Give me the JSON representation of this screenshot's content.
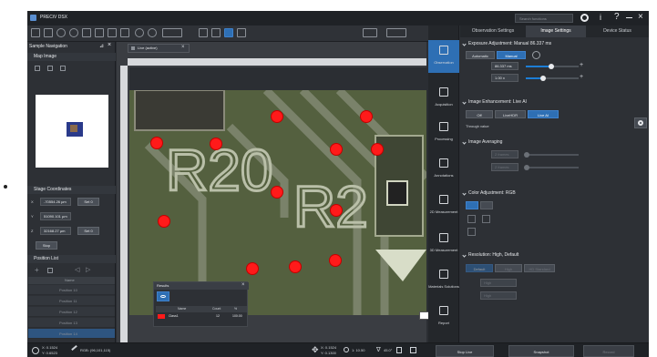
{
  "app": {
    "brand": "PRECiV DSX",
    "search_placeholder": "Search functions"
  },
  "left_panel": {
    "title": "Sample Navigation",
    "map_image": {
      "label": "Map Image"
    },
    "stage": {
      "label": "Stage Coordinates",
      "x_label": "X",
      "x_value": "-70554.26 µm",
      "y_label": "Y",
      "y_value": "51090.101 µm",
      "z_label": "Z",
      "z_value": "32168.27 µm",
      "set_label": "Set 0",
      "stop_label": "Stop"
    },
    "position_list": {
      "label": "Position List",
      "column": "Name",
      "items": [
        "Position 10",
        "Position 11",
        "Position 12",
        "Position 13",
        "Position 14"
      ]
    }
  },
  "canvas": {
    "tab_label": "Live (active)",
    "scale_label": "1 mm"
  },
  "results": {
    "title": "Results",
    "columns": [
      "Name",
      "Count",
      "%"
    ],
    "row": {
      "name": "Class1",
      "count": "12",
      "percent": "100.00"
    }
  },
  "sidebar": {
    "items": [
      "Observation",
      "Acquisition",
      "Processing",
      "Annotations",
      "2D Measurement",
      "3D Measurement",
      "Materials Solutions",
      "Report"
    ]
  },
  "right_panel": {
    "tabs": [
      "Observation Settings",
      "Image Settings",
      "Device Status"
    ],
    "exposure": {
      "title": "Exposure Adjustment: Manual 86.337 ms",
      "mode_auto": "Automatic",
      "mode_manual": "Manual",
      "value": "86.337 ms",
      "gain": "1.00 x"
    },
    "enhancement": {
      "title": "Image Enhancement: Live AI",
      "off": "Off",
      "livehdr": "LiveHDR",
      "liveai": "Live AI",
      "throughvalue": "Through value"
    },
    "averaging": {
      "title": "Image Averaging",
      "frames_a": "2 frames",
      "frames_b": "2 frames"
    },
    "color": {
      "title": "Color Adjustment: RGB"
    },
    "resolution": {
      "title": "Resolution: High, Default",
      "opt_default": "Default",
      "opt_high": "High",
      "opt_fast": "HD Standard",
      "select_a": "High",
      "select_b": "High"
    }
  },
  "status": {
    "x_coord": "X: 0.1524",
    "y_coord": "Y: 0.6523",
    "rgb": "RGB: (96,101,115)",
    "stage_x": "X: 0.1524",
    "stage_y": "Y: 0.1300",
    "zoom": "1: 10.50",
    "angle": "45.0°",
    "stop_live": "Stop Live",
    "snapshot": "Snapshot",
    "record": "Record"
  },
  "colors": {
    "accent": "#2e6fb4",
    "marker": "#ff1a1a"
  }
}
